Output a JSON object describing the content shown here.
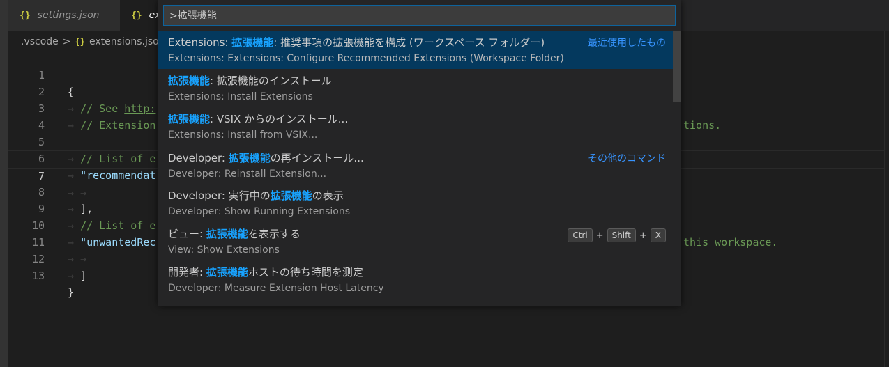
{
  "tabs": [
    {
      "icon": "{}",
      "label": "settings.json"
    },
    {
      "icon": "{}",
      "label": "ex"
    }
  ],
  "breadcrumb": {
    "folder": ".vscode",
    "sep": ">",
    "icon": "{}",
    "file": "extensions.jso"
  },
  "editor": {
    "lines": [
      {
        "n": "1"
      },
      {
        "n": "2"
      },
      {
        "n": "3"
      },
      {
        "n": "4"
      },
      {
        "n": "5"
      },
      {
        "n": "6"
      },
      {
        "n": "7"
      },
      {
        "n": "8"
      },
      {
        "n": "9"
      },
      {
        "n": "10"
      },
      {
        "n": "11"
      },
      {
        "n": "12"
      },
      {
        "n": "13"
      }
    ],
    "line1": "{",
    "line2_a": "// See ",
    "line2_url": "http:",
    "line2_right": "tions.",
    "line3": "// Extension",
    "line5": "// List of e",
    "line6": "\"recommendat",
    "line8": "],",
    "line9": "// List of e",
    "line9_right": "this workspace.",
    "line10": "\"unwantedRec",
    "line12": "]",
    "line13": "}",
    "ws_arrow": "→"
  },
  "quick_input": {
    "value": ">拡張機能"
  },
  "palette_items": [
    {
      "pre": "Extensions: ",
      "hl": "拡張機能",
      "post": ": 推奨事項の拡張機能を構成 (ワークスペース フォルダー)",
      "desc": "Extensions: Extensions: Configure Recommended Extensions (Workspace Folder)",
      "group": "最近使用したもの"
    },
    {
      "pre": "",
      "hl": "拡張機能",
      "post": ": 拡張機能のインストール",
      "desc": "Extensions: Install Extensions"
    },
    {
      "pre": "",
      "hl": "拡張機能",
      "post": ": VSIX からのインストール...",
      "desc": "Extensions: Install from VSIX..."
    },
    {
      "pre": "Developer: ",
      "hl": "拡張機能",
      "post": "の再インストール...",
      "desc": "Developer: Reinstall Extension...",
      "group": "その他のコマンド"
    },
    {
      "pre": "Developer: 実行中の",
      "hl": "拡張機能",
      "post": "の表示",
      "desc": "Developer: Show Running Extensions"
    },
    {
      "pre": "ビュー: ",
      "hl": "拡張機能",
      "post": "を表示する",
      "desc": "View: Show Extensions",
      "keys": [
        "Ctrl",
        "Shift",
        "X"
      ],
      "plus": "+"
    },
    {
      "pre": "開発者: ",
      "hl": "拡張機能",
      "post": "ホストの待ち時間を測定",
      "desc": "Developer: Measure Extension Host Latency"
    }
  ],
  "colors": {
    "accent": "#18a3ff",
    "selected_bg": "#04395e",
    "group_label": "#3794ff"
  }
}
